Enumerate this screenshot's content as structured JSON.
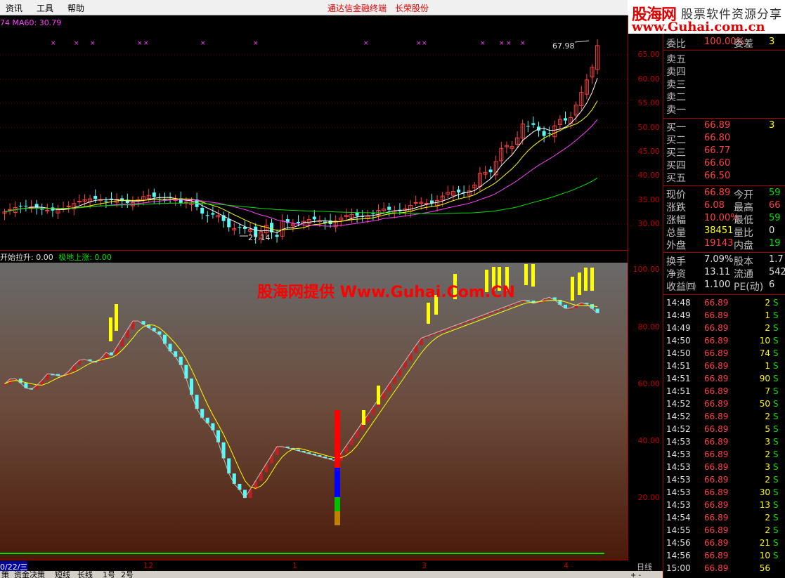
{
  "menu": {
    "items": [
      "资讯",
      "工具",
      "帮助"
    ],
    "title": "通达信金融终端",
    "stock": "长荣股份"
  },
  "brand": {
    "logo": "股海网",
    "slogan": "股票软件资源分享",
    "url": "www.Guhai.com.cn"
  },
  "main_chart": {
    "ma_label": "74  MA60: 30.79",
    "high_label": "67.98",
    "low_label": "27.14",
    "y_ticks": [
      "65.00",
      "60.00",
      "55.00",
      "50.00",
      "45.00",
      "40.00",
      "35.00",
      "30.00"
    ]
  },
  "sub_chart": {
    "label_1": "开始拉升: 0.00",
    "label_2": "极地上涨: 0.00",
    "watermark": "股海网提供 Www.Guhai.Com.CN",
    "y_ticks": [
      "100.00",
      "80.00",
      "60.00",
      "40.00",
      "20.00"
    ]
  },
  "date_axis": {
    "labels": [
      "0/22/三",
      "12",
      "1",
      "3",
      "4"
    ]
  },
  "bottom": {
    "tabs": [
      "策",
      "资金决策",
      "短线",
      "长线",
      "1号",
      "2号"
    ],
    "period": "日线",
    "plus_minus": "+ -"
  },
  "colors": {
    "up": "#ff4040",
    "down": "#54fcfc",
    "ma5": "#ffffff",
    "ma10": "#ffff00",
    "ma20": "#ff40ff",
    "ma60": "#00e000"
  },
  "quote": {
    "weibi": {
      "label": "委比",
      "value": "100.00%",
      "label2": "委差",
      "value2": "3"
    },
    "sell": [
      {
        "label": "卖五",
        "price": "",
        "vol": ""
      },
      {
        "label": "卖四",
        "price": "",
        "vol": ""
      },
      {
        "label": "卖三",
        "price": "",
        "vol": ""
      },
      {
        "label": "卖二",
        "price": "",
        "vol": ""
      },
      {
        "label": "卖一",
        "price": "",
        "vol": ""
      }
    ],
    "buy": [
      {
        "label": "买一",
        "price": "66.89",
        "vol": "3"
      },
      {
        "label": "买二",
        "price": "66.80",
        "vol": ""
      },
      {
        "label": "买三",
        "price": "66.77",
        "vol": ""
      },
      {
        "label": "买四",
        "price": "66.60",
        "vol": ""
      },
      {
        "label": "买五",
        "price": "66.50",
        "vol": ""
      }
    ],
    "stats": [
      {
        "l1": "现价",
        "v1": "66.89",
        "l2": "今开",
        "v2": "59"
      },
      {
        "l1": "涨跌",
        "v1": "6.08",
        "l2": "最高",
        "v2": "66"
      },
      {
        "l1": "涨幅",
        "v1": "10.00%",
        "l2": "最低",
        "v2": "59"
      },
      {
        "l1": "总量",
        "v1": "38451",
        "l2": "量比",
        "v2": "0"
      },
      {
        "l1": "外盘",
        "v1": "19143",
        "l2": "内盘",
        "v2": "19"
      }
    ],
    "fundamentals": [
      {
        "l1": "换手",
        "v1": "7.09%",
        "l2": "股本",
        "v2": "1.7"
      },
      {
        "l1": "净资",
        "v1": "13.11",
        "l2": "流通",
        "v2": "542"
      },
      {
        "l1": "收益㈣",
        "v1": "1.100",
        "l2": "PE(动)",
        "v2": "6"
      }
    ]
  },
  "ticks": [
    {
      "time": "14:48",
      "price": "66.89",
      "vol": "2",
      "side": "S"
    },
    {
      "time": "14:49",
      "price": "66.89",
      "vol": "1",
      "side": "S"
    },
    {
      "time": "14:49",
      "price": "66.89",
      "vol": "2",
      "side": "S"
    },
    {
      "time": "14:50",
      "price": "66.89",
      "vol": "10",
      "side": "S"
    },
    {
      "time": "14:50",
      "price": "66.89",
      "vol": "74",
      "side": "S"
    },
    {
      "time": "14:51",
      "price": "66.89",
      "vol": "1",
      "side": "S"
    },
    {
      "time": "14:51",
      "price": "66.89",
      "vol": "90",
      "side": "S"
    },
    {
      "time": "14:51",
      "price": "66.89",
      "vol": "7",
      "side": "S"
    },
    {
      "time": "14:52",
      "price": "66.89",
      "vol": "50",
      "side": "S"
    },
    {
      "time": "14:52",
      "price": "66.89",
      "vol": "2",
      "side": "S"
    },
    {
      "time": "14:52",
      "price": "66.89",
      "vol": "5",
      "side": "S"
    },
    {
      "time": "14:53",
      "price": "66.89",
      "vol": "3",
      "side": "S"
    },
    {
      "time": "14:53",
      "price": "66.89",
      "vol": "2",
      "side": "S"
    },
    {
      "time": "14:53",
      "price": "66.89",
      "vol": "3",
      "side": "S"
    },
    {
      "time": "14:53",
      "price": "66.89",
      "vol": "2",
      "side": "S"
    },
    {
      "time": "14:53",
      "price": "66.89",
      "vol": "30",
      "side": "S"
    },
    {
      "time": "14:53",
      "price": "66.89",
      "vol": "13",
      "side": "S"
    },
    {
      "time": "14:54",
      "price": "66.89",
      "vol": "2",
      "side": "S"
    },
    {
      "time": "14:55",
      "price": "66.89",
      "vol": "2",
      "side": "S"
    },
    {
      "time": "14:56",
      "price": "66.89",
      "vol": "21",
      "side": "S"
    },
    {
      "time": "14:56",
      "price": "66.89",
      "vol": "10",
      "side": "S"
    },
    {
      "time": "15:00",
      "price": "66.89",
      "vol": "56",
      "side": ""
    }
  ]
}
